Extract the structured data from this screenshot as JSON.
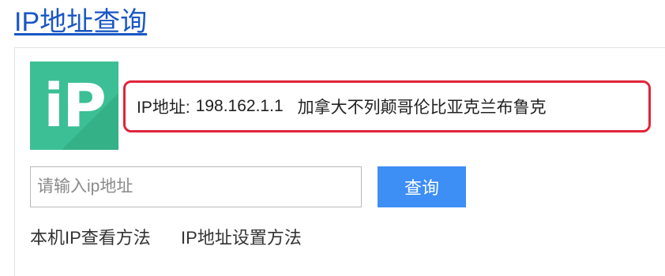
{
  "header": {
    "title": "IP地址查询"
  },
  "logo": {
    "text": "iP",
    "icon": "ip-logo-icon",
    "color": "#3cbf94"
  },
  "result": {
    "label": "IP地址:",
    "ip": "198.162.1.1",
    "location": "加拿大不列颠哥伦比亚克兰布鲁克",
    "border_color": "#e0253a"
  },
  "search": {
    "placeholder": "请输入ip地址",
    "value": "",
    "button_label": "查询",
    "button_color": "#3d8ef5"
  },
  "links": {
    "local_ip": "本机IP查看方法",
    "ip_settings": "IP地址设置方法"
  }
}
